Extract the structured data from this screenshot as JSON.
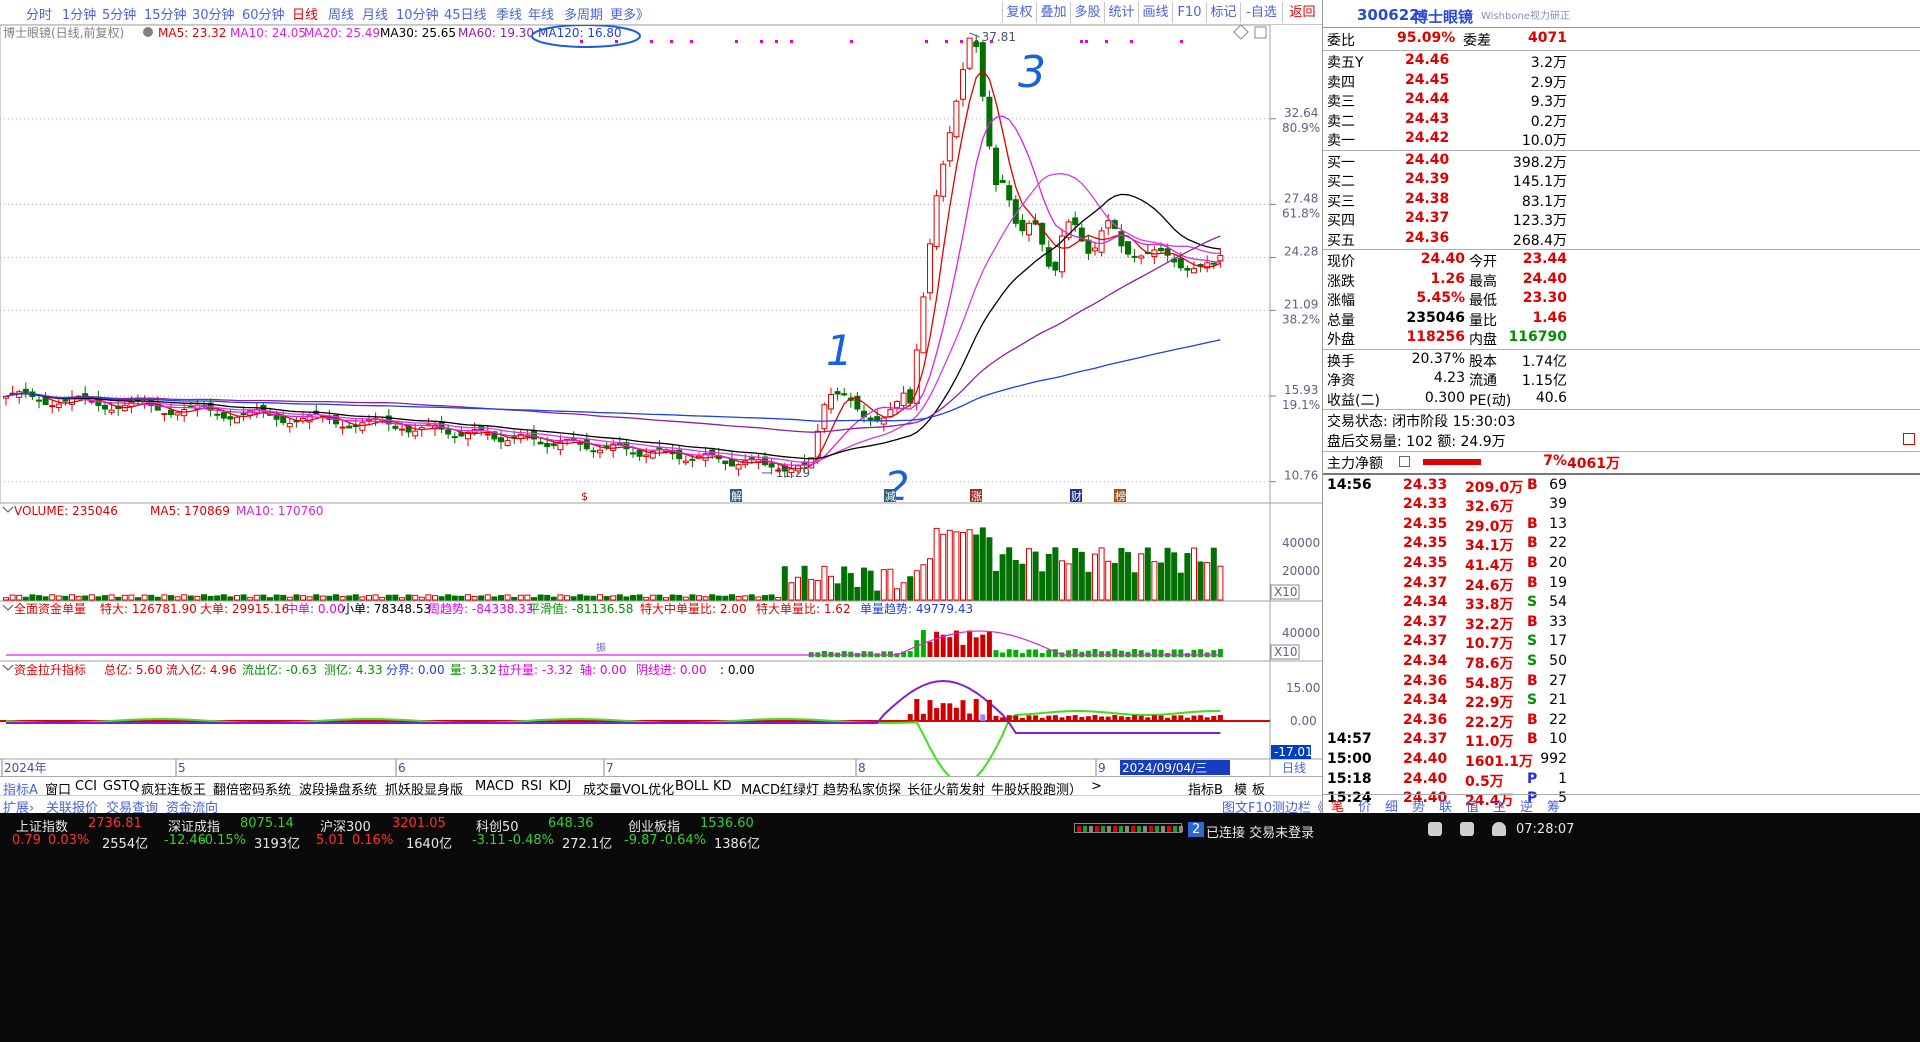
{
  "period_tabs": [
    {
      "label": "分时",
      "active": false
    },
    {
      "label": "1分钟",
      "active": false
    },
    {
      "label": "5分钟",
      "active": false
    },
    {
      "label": "15分钟",
      "active": false
    },
    {
      "label": "30分钟",
      "active": false
    },
    {
      "label": "60分钟",
      "active": false
    },
    {
      "label": "日线",
      "active": true
    },
    {
      "label": "周线",
      "active": false
    },
    {
      "label": "月线",
      "active": false
    },
    {
      "label": "10分钟",
      "active": false
    },
    {
      "label": "45日线",
      "active": false
    },
    {
      "label": "季线",
      "active": false
    },
    {
      "label": "年线",
      "active": false
    },
    {
      "label": "多周期",
      "active": false
    },
    {
      "label": "更多》",
      "active": false
    }
  ],
  "tool_buttons": [
    {
      "label": "复权",
      "red": false
    },
    {
      "label": "叠加",
      "red": false
    },
    {
      "label": "多股",
      "red": false
    },
    {
      "label": "统计",
      "red": false
    },
    {
      "label": "画线",
      "red": false
    },
    {
      "label": "F10",
      "red": false
    },
    {
      "label": "标记",
      "red": false
    },
    {
      "label": "-自选",
      "red": false
    },
    {
      "label": "返回",
      "red": true
    }
  ],
  "chart": {
    "title": "博士眼镜(日线,前复权)",
    "ma_labels": [
      {
        "text": "MA5: 23.32",
        "color": "#e00000"
      },
      {
        "text": "MA10: 24.05",
        "color": "#e020e0"
      },
      {
        "text": "MA20: 25.49",
        "color": "#e020e0"
      },
      {
        "text": "MA30: 25.65",
        "color": "#000000"
      },
      {
        "text": "MA60: 19.30",
        "color": "#9020a0"
      },
      {
        "text": "MA120: 16.80",
        "color": "#2040e0"
      }
    ],
    "price_axis": [
      {
        "price": "32.64",
        "pct": "80.9%"
      },
      {
        "price": "27.48",
        "pct": "61.8%"
      },
      {
        "price": "24.28",
        "pct": ""
      },
      {
        "price": "21.09",
        "pct": "38.2%"
      },
      {
        "price": "15.93",
        "pct": "19.1%"
      },
      {
        "price": "10.76",
        "pct": ""
      }
    ],
    "high_label": "37.81",
    "low_label": "11.29",
    "annotations": [
      "1",
      "2",
      "3"
    ],
    "event_marks": [
      "$",
      "解",
      "减",
      "涨",
      "财",
      "榜"
    ],
    "volume_label": "VOLUME: 235046",
    "vol_ma5": "MA5: 170869",
    "vol_ma10": "MA10: 170760",
    "vol_axis": [
      "40000",
      "20000"
    ],
    "vol_unit": "X10",
    "fund_title": "全面资金单量",
    "fund_items": [
      {
        "text": "特大: 126781.90",
        "color": "#e00000"
      },
      {
        "text": "大单: 29915.16",
        "color": "#e00000"
      },
      {
        "text": "中单: 0.00",
        "color": "#e000e0"
      },
      {
        "text": "小单: 78348.53",
        "color": "#000000"
      },
      {
        "text": "周趋势: -84338.33",
        "color": "#e000e0"
      },
      {
        "text": "平滑值: -81136.58",
        "color": "#009000"
      },
      {
        "text": "特大中单量比: 2.00",
        "color": "#e00000"
      },
      {
        "text": "特大单量比: 1.62",
        "color": "#e00000"
      },
      {
        "text": "单量趋势: 49779.43",
        "color": "#2040e0"
      }
    ],
    "fund_axis": "40000",
    "fund_unit": "X10",
    "fund_mark": "振",
    "lift_title": "资金拉升指标",
    "lift_items": [
      {
        "text": "总亿: 5.60",
        "color": "#e00000"
      },
      {
        "text": "流入亿: 4.96",
        "color": "#e00000"
      },
      {
        "text": "流出亿: -0.63",
        "color": "#009000"
      },
      {
        "text": "测亿: 4.33",
        "color": "#009000"
      },
      {
        "text": "分界: 0.00",
        "color": "#2040e0"
      },
      {
        "text": "量: 3.32",
        "color": "#009000"
      },
      {
        "text": "拉升量: -3.32",
        "color": "#e000e0"
      },
      {
        "text": "轴: 0.00",
        "color": "#e000e0"
      },
      {
        "text": "阴线进: 0.00",
        "color": "#e000e0"
      },
      {
        "text": ": 0.00",
        "color": "#000000"
      }
    ],
    "lift_axis": [
      "15.00",
      "0.00"
    ],
    "lift_min": "-17.01",
    "date_axis": [
      "2024年",
      "5",
      "6",
      "7",
      "8",
      "9"
    ],
    "cursor_date": "2024/09/04/三",
    "date_unit": "日线"
  },
  "bottom_tabs": [
    "指标A",
    "窗口",
    "CCI",
    "GSTQ",
    "疯狂连板王",
    "翻倍密码系统",
    "波段操盘系统",
    "抓妖股显身版",
    "MACD",
    "RSI",
    "KDJ",
    "成交量VOL优化",
    "BOLL",
    "KD",
    "MACD红绿灯",
    "趋势私家侦探",
    "长征火箭发射",
    "牛股妖股跑测）",
    ">"
  ],
  "bottom_right_tabs": [
    "指标B",
    "模",
    "板"
  ],
  "bottom_tabs2": [
    "扩展›",
    "关联报价",
    "交易查询",
    "资金流向"
  ],
  "bottom_tabs2_right": [
    "图文F10",
    "测边栏《"
  ],
  "panel": {
    "code": "300622",
    "name": "博士眼镜",
    "subtitle": "Wishbone视力研正",
    "weibi_label": "委比",
    "weibi": "95.09%",
    "weicha_label": "委差",
    "weicha": "4071",
    "asks": [
      {
        "label": "卖五Y",
        "price": "24.46",
        "vol": "3.2万"
      },
      {
        "label": "卖四",
        "price": "24.45",
        "vol": "2.9万"
      },
      {
        "label": "卖三",
        "price": "24.44",
        "vol": "9.3万"
      },
      {
        "label": "卖二",
        "price": "24.43",
        "vol": "0.2万"
      },
      {
        "label": "卖一",
        "price": "24.42",
        "vol": "10.0万"
      }
    ],
    "bids": [
      {
        "label": "买一",
        "price": "24.40",
        "vol": "398.2万"
      },
      {
        "label": "买二",
        "price": "24.39",
        "vol": "145.1万"
      },
      {
        "label": "买三",
        "price": "24.38",
        "vol": "83.1万"
      },
      {
        "label": "买四",
        "price": "24.37",
        "vol": "123.3万"
      },
      {
        "label": "买五",
        "price": "24.36",
        "vol": "268.4万"
      }
    ],
    "quote": [
      {
        "l1": "现价",
        "v1": "24.40",
        "c1": "red",
        "l2": "今开",
        "v2": "23.44",
        "c2": "red"
      },
      {
        "l1": "涨跌",
        "v1": "1.26",
        "c1": "red",
        "l2": "最高",
        "v2": "24.40",
        "c2": "red"
      },
      {
        "l1": "涨幅",
        "v1": "5.45%",
        "c1": "red",
        "l2": "最低",
        "v2": "23.30",
        "c2": "red"
      },
      {
        "l1": "总量",
        "v1": "235046",
        "c1": "blk",
        "l2": "量比",
        "v2": "1.46",
        "c2": "red"
      },
      {
        "l1": "外盘",
        "v1": "118256",
        "c1": "red",
        "l2": "内盘",
        "v2": "116790",
        "c2": "grn"
      }
    ],
    "fundamental": [
      {
        "l1": "换手",
        "v1": "20.37%",
        "l2": "股本",
        "v2": "1.74亿"
      },
      {
        "l1": "净资",
        "v1": "4.23",
        "l2": "流通",
        "v2": "1.15亿"
      },
      {
        "l1": "收益(二)",
        "v1": "0.300",
        "l2": "PE(动)",
        "v2": "40.6"
      }
    ],
    "trade_state": "交易状态: 闭市阶段 15:30:03",
    "after_hours": "盘后交易量: 102  额: 24.9万",
    "main_net_label": "主力净额",
    "main_net_value": "4061万",
    "main_net_pct": "7%",
    "ticks": [
      {
        "time": "14:56",
        "price": "24.33",
        "vol": "209.0万",
        "bs": "B",
        "n": "69"
      },
      {
        "time": "",
        "price": "24.33",
        "vol": "32.6万",
        "bs": "",
        "n": "39"
      },
      {
        "time": "",
        "price": "24.35",
        "vol": "29.0万",
        "bs": "B",
        "n": "13"
      },
      {
        "time": "",
        "price": "24.35",
        "vol": "34.1万",
        "bs": "B",
        "n": "22"
      },
      {
        "time": "",
        "price": "24.35",
        "vol": "41.4万",
        "bs": "B",
        "n": "20"
      },
      {
        "time": "",
        "price": "24.37",
        "vol": "24.6万",
        "bs": "B",
        "n": "19"
      },
      {
        "time": "",
        "price": "24.34",
        "vol": "33.8万",
        "bs": "S",
        "n": "54"
      },
      {
        "time": "",
        "price": "24.37",
        "vol": "32.2万",
        "bs": "B",
        "n": "33"
      },
      {
        "time": "",
        "price": "24.37",
        "vol": "10.7万",
        "bs": "S",
        "n": "17"
      },
      {
        "time": "",
        "price": "24.34",
        "vol": "78.6万",
        "bs": "S",
        "n": "50"
      },
      {
        "time": "",
        "price": "24.36",
        "vol": "54.8万",
        "bs": "B",
        "n": "27"
      },
      {
        "time": "",
        "price": "24.34",
        "vol": "22.9万",
        "bs": "S",
        "n": "21"
      },
      {
        "time": "",
        "price": "24.36",
        "vol": "22.2万",
        "bs": "B",
        "n": "22"
      },
      {
        "time": "14:57",
        "price": "24.37",
        "vol": "11.0万",
        "bs": "B",
        "n": "10"
      },
      {
        "time": "15:00",
        "price": "24.40",
        "vol": "1601.1万",
        "bs": "",
        "n": "992"
      },
      {
        "time": "15:18",
        "price": "24.40",
        "vol": "0.5万",
        "bs": "P",
        "n": "1"
      },
      {
        "time": "15:24",
        "price": "24.40",
        "vol": "24.4万",
        "bs": "P",
        "n": "5"
      }
    ],
    "panel_tabs": [
      "笔",
      "价",
      "细",
      "势",
      "联",
      "值",
      "主",
      "逆",
      "筹"
    ]
  },
  "status": {
    "indices": [
      {
        "name": "上证指数",
        "value": "2736.81",
        "chg": "0.79",
        "pct": "0.03%",
        "amt": "2554亿",
        "color": "#ff3030"
      },
      {
        "name": "深证成指",
        "value": "8075.14",
        "chg": "-12.46",
        "pct": "-0.15%",
        "amt": "3193亿",
        "color": "#30d030"
      },
      {
        "name": "沪深300",
        "value": "3201.05",
        "chg": "5.01",
        "pct": "0.16%",
        "amt": "1640亿",
        "color": "#ff3030"
      },
      {
        "name": "科创50",
        "value": "648.36",
        "chg": "-3.11",
        "pct": "-0.48%",
        "amt": "272.1亿",
        "color": "#30d030"
      },
      {
        "name": "创业板指",
        "value": "1536.60",
        "chg": "-9.87",
        "pct": "-0.64%",
        "amt": "1386亿",
        "color": "#30d030"
      }
    ],
    "conn_num": "2",
    "conn_text": "已连接 交易未登录",
    "clock": "07:28:07"
  }
}
